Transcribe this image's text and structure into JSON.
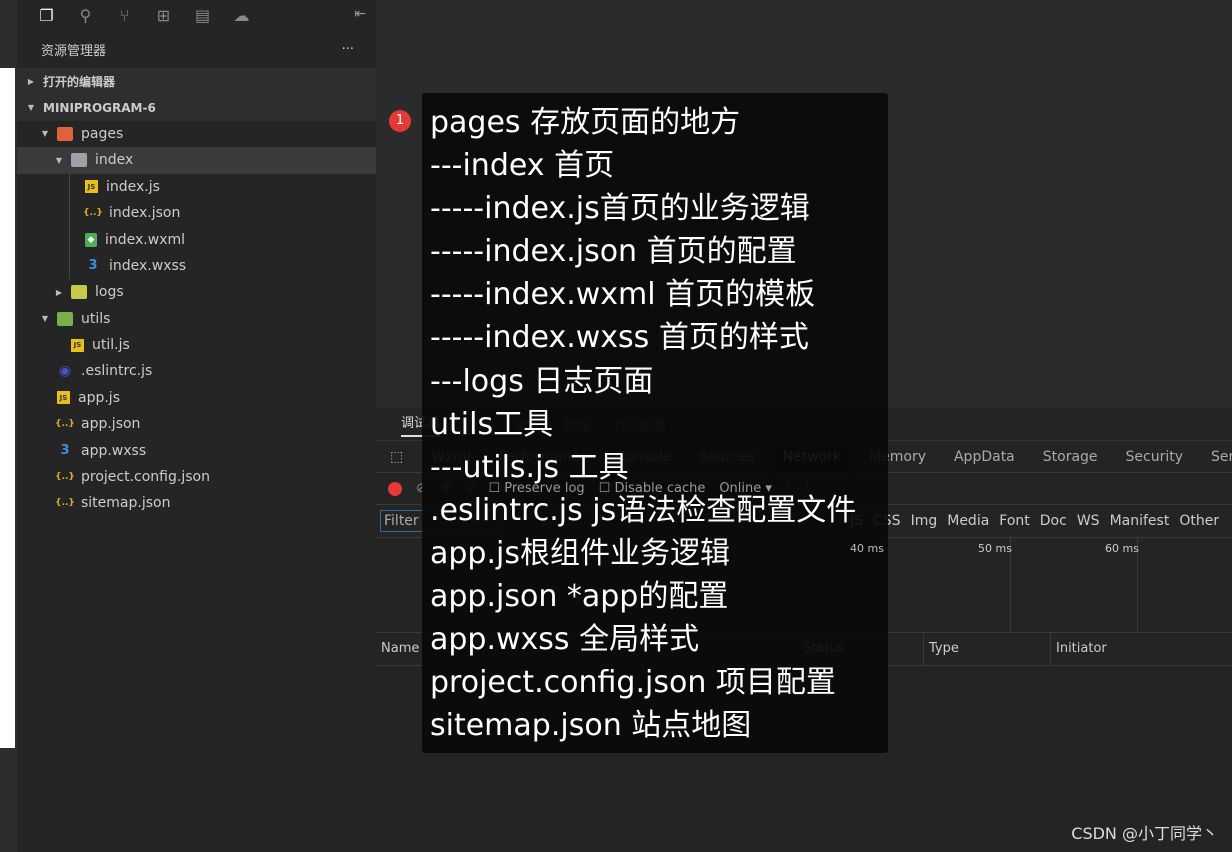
{
  "activity_icons": [
    "files-icon",
    "search-icon",
    "source-control-icon",
    "extensions-icon",
    "outline-icon",
    "docker-icon"
  ],
  "explorer": {
    "title": "资源管理器",
    "more": "···",
    "open_editors": "打开的编辑器",
    "project": "MINIPROGRAM-6",
    "tree": [
      {
        "label": "pages",
        "depth": 1,
        "type": "folder-pages",
        "open": true
      },
      {
        "label": "index",
        "depth": 2,
        "type": "folder",
        "open": true,
        "selected": true
      },
      {
        "label": "index.js",
        "depth": 3,
        "type": "js"
      },
      {
        "label": "index.json",
        "depth": 3,
        "type": "json"
      },
      {
        "label": "index.wxml",
        "depth": 3,
        "type": "wxml"
      },
      {
        "label": "index.wxss",
        "depth": 3,
        "type": "wxss"
      },
      {
        "label": "logs",
        "depth": 2,
        "type": "folder-logs",
        "open": false
      },
      {
        "label": "utils",
        "depth": 1,
        "type": "folder-utils",
        "open": true
      },
      {
        "label": "util.js",
        "depth": 2,
        "type": "js"
      },
      {
        "label": ".eslintrc.js",
        "depth": 1,
        "type": "eslint"
      },
      {
        "label": "app.js",
        "depth": 1,
        "type": "js"
      },
      {
        "label": "app.json",
        "depth": 1,
        "type": "json"
      },
      {
        "label": "app.wxss",
        "depth": 1,
        "type": "wxss"
      },
      {
        "label": "project.config.json",
        "depth": 1,
        "type": "json"
      },
      {
        "label": "sitemap.json",
        "depth": 1,
        "type": "json"
      }
    ]
  },
  "panel_tabs": [
    "调试器",
    "问题",
    "输出",
    "终端",
    "代码质量"
  ],
  "devtools_tabs": [
    "Wxml",
    "Performance",
    "Console",
    "Sources",
    "Network",
    "Memory",
    "AppData",
    "Storage",
    "Security",
    "Sensor"
  ],
  "devtools_active": "Network",
  "toolbar": {
    "preserve_log": "Preserve log",
    "disable_cache": "Disable cache",
    "throttle": "Online"
  },
  "filter": {
    "placeholder": "Filter",
    "types": [
      "JS",
      "CSS",
      "Img",
      "Media",
      "Font",
      "Doc",
      "WS",
      "Manifest",
      "Other"
    ]
  },
  "timeline_ticks": [
    "40 ms",
    "50 ms",
    "60 ms"
  ],
  "columns": [
    "Name",
    "Status",
    "Type",
    "Initiator"
  ],
  "annotation": {
    "badge": "1",
    "lines": [
      "pages 存放页面的地方",
      "---index 首页",
      "-----index.js首页的业务逻辑",
      "-----index.json 首页的配置",
      "-----index.wxml 首页的模板",
      "-----index.wxss 首页的样式",
      "---logs 日志页面",
      "utils工具",
      "---utils.js 工具",
      ".eslintrc.js js语法检查配置文件",
      "app.js根组件业务逻辑",
      "app.json *app的配置",
      "app.wxss 全局样式",
      "project.config.json 项目配置",
      "sitemap.json 站点地图"
    ]
  },
  "watermark": "CSDN @小丁同学丶"
}
